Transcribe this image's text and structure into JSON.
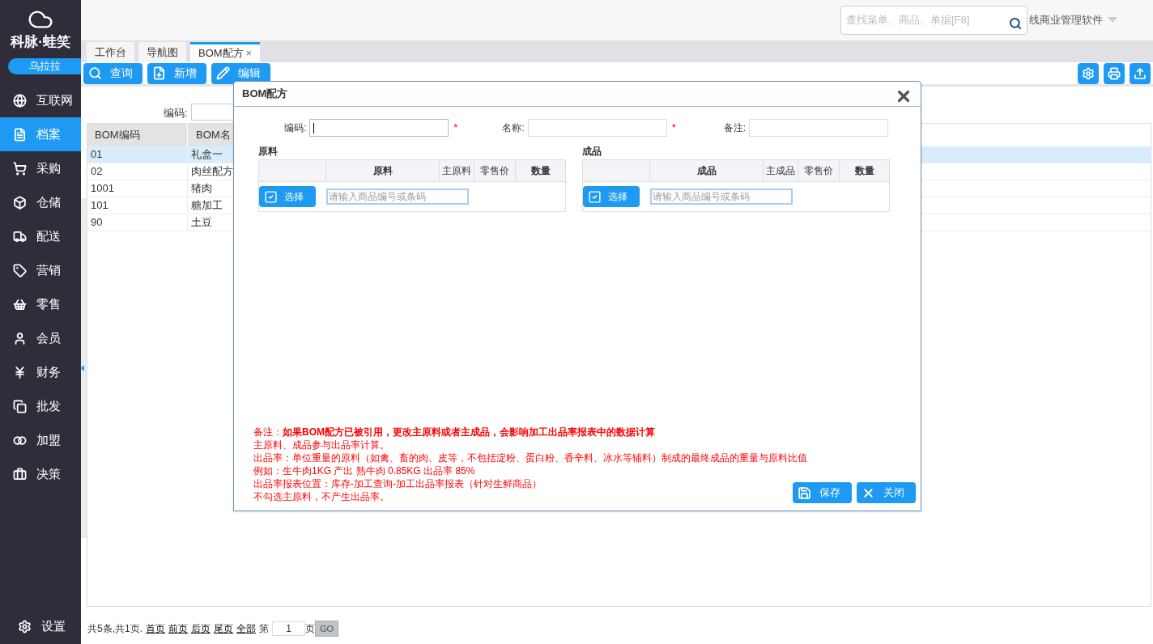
{
  "sidebar": {
    "logo": "科脉·蛙笑",
    "user": "乌拉拉",
    "items": [
      {
        "label": "互联网",
        "selected": false
      },
      {
        "label": "档案",
        "selected": true
      },
      {
        "label": "采购",
        "selected": false
      },
      {
        "label": "仓储",
        "selected": false
      },
      {
        "label": "配送",
        "selected": false
      },
      {
        "label": "营销",
        "selected": false
      },
      {
        "label": "零售",
        "selected": false
      },
      {
        "label": "会员",
        "selected": false
      },
      {
        "label": "财务",
        "selected": false
      },
      {
        "label": "批发",
        "selected": false
      },
      {
        "label": "加盟",
        "selected": false
      },
      {
        "label": "决策",
        "selected": false
      }
    ],
    "footer": {
      "label": "设置"
    }
  },
  "header": {
    "search_placeholder": "查找菜单、商品、单据[F8]",
    "app_name": "线商业管理软件"
  },
  "tabs": [
    {
      "label": "工作台",
      "selected": false
    },
    {
      "label": "导航图",
      "selected": false
    },
    {
      "label": "BOM配方",
      "selected": true,
      "close": "×"
    }
  ],
  "toolbar": [
    {
      "label": "查询"
    },
    {
      "label": "新增"
    },
    {
      "label": "编辑"
    }
  ],
  "filter": {
    "label": "编码:"
  },
  "table": {
    "columns": [
      "BOM编码",
      "BOM名"
    ],
    "rows": [
      {
        "cells": [
          "01",
          "礼盒一"
        ],
        "selected": true
      },
      {
        "cells": [
          "02",
          "肉丝配方"
        ],
        "selected": false
      },
      {
        "cells": [
          "1001",
          "猪肉"
        ],
        "selected": false
      },
      {
        "cells": [
          "101",
          "糖加工"
        ],
        "selected": false
      },
      {
        "cells": [
          "90",
          "土豆"
        ],
        "selected": false
      }
    ]
  },
  "pagination": {
    "summary": "共5条,共1页.",
    "links": [
      "首页",
      "前页",
      "后页",
      "尾页",
      "全部"
    ],
    "prefix": "第",
    "page": "1",
    "suffix": "页",
    "go": "GO"
  },
  "dialog": {
    "title": "BOM配方",
    "fields": [
      {
        "label": "编码:",
        "required_mark": "*",
        "focused": true
      },
      {
        "label": "名称:",
        "required_mark": "*",
        "focused": false
      },
      {
        "label": "备注:",
        "focused": false
      }
    ],
    "sections": [
      {
        "title": "原料",
        "columns": [
          "原料",
          "主原料",
          "零售价",
          "数量"
        ],
        "select_button": "选择",
        "placeholder": "请输入商品编号或条码"
      },
      {
        "title": "成品",
        "columns": [
          "成品",
          "主成品",
          "零售价",
          "数量"
        ],
        "select_button": "选择",
        "placeholder": "请输入商品编号或条码"
      }
    ],
    "notes": [
      {
        "text": "备注：**如果BOM配方已被引用，更改主原料或者主成品，会影响加工出品率报表中的数据计算**"
      },
      {
        "text": "主原料、成品参与出品率计算。"
      },
      {
        "text": "出品率：单位重量的原料（如禽、畜的肉、皮等，不包括淀粉、蛋白粉、香辛料、冰水等辅料）制成的最终成品的重量与原料比值"
      },
      {
        "text": "例如：生牛肉1KG 产出 熟牛肉 0.85KG 出品率 85%"
      },
      {
        "text": "出品率报表位置：库存-加工查询-加工出品率报表（针对生鲜商品）"
      },
      {
        "text": "不勾选主原料，不产生出品率。"
      }
    ],
    "buttons": [
      {
        "label": "保存"
      },
      {
        "label": "关闭"
      }
    ]
  }
}
